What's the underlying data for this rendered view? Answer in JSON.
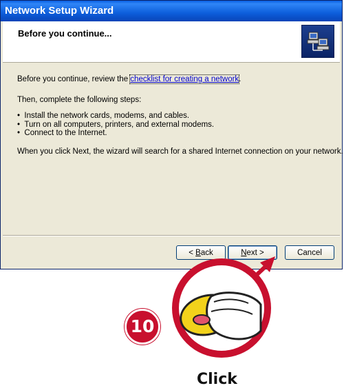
{
  "window": {
    "title": "Network Setup Wizard"
  },
  "header": {
    "title": "Before you continue..."
  },
  "content": {
    "intro_before_link": "Before you continue, review the ",
    "link_text": "checklist for creating a network",
    "intro_after_link": ".",
    "steps_intro": "Then, complete the following steps:",
    "steps": [
      "Install the network cards, modems, and cables.",
      "Turn on all computers, printers, and external modems.",
      "Connect to the Internet."
    ],
    "note": "When you click Next, the wizard will search for a shared Internet connection on your network."
  },
  "buttons": {
    "back": {
      "prefix": "< ",
      "mnemonic": "B",
      "rest": "ack"
    },
    "next": {
      "mnemonic": "N",
      "rest": "ext >"
    },
    "cancel": "Cancel"
  },
  "overlay": {
    "step_number": "10",
    "action_label": "Click",
    "accent_color": "#c8102e"
  }
}
